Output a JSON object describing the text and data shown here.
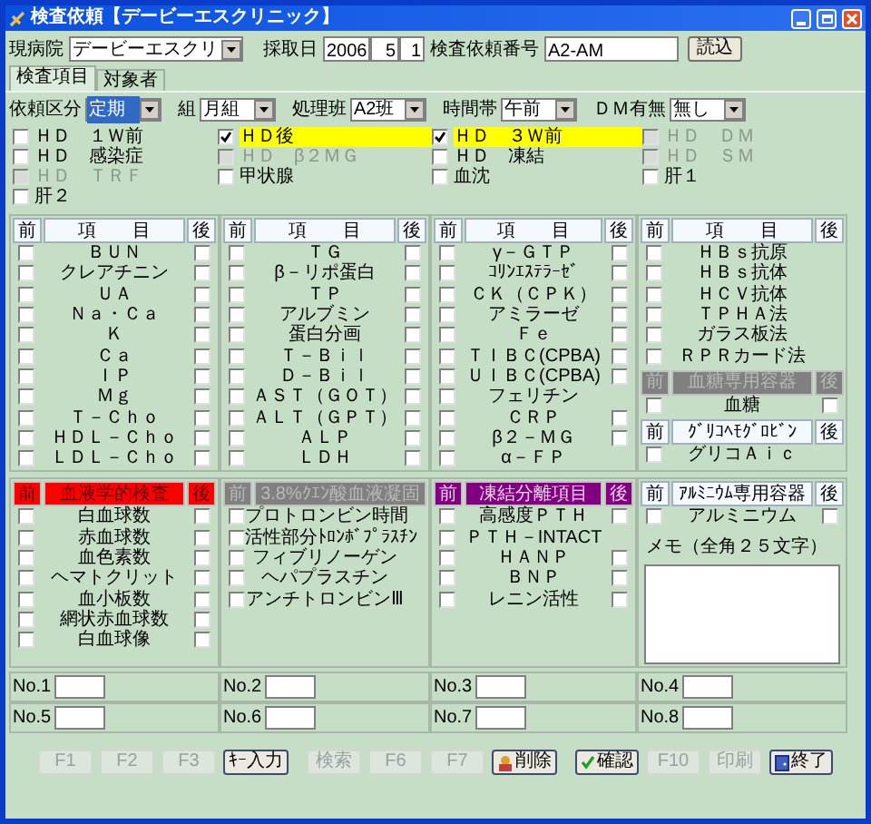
{
  "window": {
    "title": "検査依頼【デービーエスクリニック】"
  },
  "header": {
    "hospital_label": "現病院",
    "hospital": "デービーエスクリ",
    "date_label": "採取日",
    "year": "2006",
    "month": "5",
    "day": "1",
    "request_no_label": "検査依頼番号",
    "request_no": "A2-AM",
    "load_button": "読込"
  },
  "tabs": [
    {
      "label": "検査項目",
      "selected": true
    },
    {
      "label": "対象者",
      "selected": false
    }
  ],
  "filters": [
    {
      "label": "依頼区分",
      "value": "定期",
      "highlighted": true
    },
    {
      "label": "組",
      "value": "月組",
      "highlighted": false
    },
    {
      "label": "処理班",
      "value": "A2班",
      "highlighted": false
    },
    {
      "label": "時間帯",
      "value": "午前",
      "highlighted": false
    },
    {
      "label": "ＤＭ有無",
      "value": "無し",
      "highlighted": false
    }
  ],
  "option_columns": [
    [
      {
        "label": "ＨＤ　１Ｗ前",
        "checked": false,
        "disabled": false
      },
      {
        "label": "ＨＤ　感染症",
        "checked": false,
        "disabled": false
      },
      {
        "label": "ＨＤ　ＴＲＦ",
        "checked": false,
        "disabled": true
      },
      {
        "label": "肝２",
        "checked": false,
        "disabled": false
      }
    ],
    [
      {
        "label": "ＨＤ後",
        "checked": true,
        "disabled": false
      },
      {
        "label": "ＨＤ　β２ＭＧ",
        "checked": false,
        "disabled": true
      },
      {
        "label": "甲状腺",
        "checked": false,
        "disabled": false
      }
    ],
    [
      {
        "label": "ＨＤ　３Ｗ前",
        "checked": true,
        "disabled": false
      },
      {
        "label": "ＨＤ　凍結",
        "checked": false,
        "disabled": false
      },
      {
        "label": "血沈",
        "checked": false,
        "disabled": false
      }
    ],
    [
      {
        "label": "ＨＤ　ＤＭ",
        "checked": false,
        "disabled": true
      },
      {
        "label": "ＨＤ　ＳＭ",
        "checked": false,
        "disabled": true
      },
      {
        "label": "肝１",
        "checked": false,
        "disabled": false
      }
    ]
  ],
  "panels_top": [
    {
      "sections": [
        {
          "header": {
            "kind": "plain",
            "before": "前",
            "title": "項　　目",
            "after": "後"
          },
          "items": [
            {
              "name": "ＢＵＮ",
              "before": false,
              "after": false
            },
            {
              "name": "クレアチニン",
              "before": false,
              "after": false
            },
            {
              "name": "ＵＡ",
              "before": false,
              "after": false
            },
            {
              "name": "Ｎａ・Ｃａ",
              "before": false,
              "after": false
            },
            {
              "name": "Ｋ",
              "before": false,
              "after": false
            },
            {
              "name": "Ｃａ",
              "before": false,
              "after": false
            },
            {
              "name": "ＩＰ",
              "before": false,
              "after": false
            },
            {
              "name": "Ｍｇ",
              "before": false,
              "after": false
            },
            {
              "name": "Ｔ－Ｃｈｏ",
              "before": false,
              "after": false
            },
            {
              "name": "ＨＤＬ－Ｃｈｏ",
              "before": false,
              "after": false
            },
            {
              "name": "ＬＤＬ－Ｃｈｏ",
              "before": false,
              "after": false
            }
          ]
        }
      ]
    },
    {
      "sections": [
        {
          "header": {
            "kind": "plain",
            "before": "前",
            "title": "項　　目",
            "after": "後"
          },
          "items": [
            {
              "name": "ＴＧ",
              "before": false,
              "after": false
            },
            {
              "name": "β－リポ蛋白",
              "before": false,
              "after": false
            },
            {
              "name": "ＴＰ",
              "before": false,
              "after": false
            },
            {
              "name": "アルブミン",
              "before": false,
              "after": false
            },
            {
              "name": "蛋白分画",
              "before": false,
              "after": false
            },
            {
              "name": "Ｔ－Ｂｉｌ",
              "before": false,
              "after": false
            },
            {
              "name": "Ｄ－Ｂｉｌ",
              "before": false,
              "after": false
            },
            {
              "name": "ＡＳＴ（ＧＯＴ）",
              "before": false,
              "after": false
            },
            {
              "name": "ＡＬＴ（ＧＰＴ）",
              "before": false,
              "after": false
            },
            {
              "name": "ＡＬＰ",
              "before": false,
              "after": false
            },
            {
              "name": "ＬＤＨ",
              "before": false,
              "after": false
            }
          ]
        }
      ]
    },
    {
      "sections": [
        {
          "header": {
            "kind": "plain",
            "before": "前",
            "title": "項　　目",
            "after": "後"
          },
          "items": [
            {
              "name": "γ－ＧＴＰ",
              "before": false,
              "after": false
            },
            {
              "name": "ｺﾘﾝｴｽﾃﾗｰｾﾞ",
              "before": false,
              "after": false
            },
            {
              "name": "ＣＫ（ＣＰＫ）",
              "before": false,
              "after": false
            },
            {
              "name": "アミラーゼ",
              "before": false,
              "after": false
            },
            {
              "name": "Ｆｅ",
              "before": false,
              "after": false
            },
            {
              "name": "ＴＩＢＣ(CPBA)",
              "before": false,
              "after": false
            },
            {
              "name": "ＵＩＢＣ(CPBA)",
              "before": false,
              "after": false
            },
            {
              "name": "フェリチン",
              "before": false
            },
            {
              "name": "ＣＲＰ",
              "before": false,
              "after": false
            },
            {
              "name": "β２－ＭＧ",
              "before": false,
              "after": false
            },
            {
              "name": "α－ＦＰ",
              "before": false
            }
          ]
        }
      ]
    },
    {
      "sections": [
        {
          "header": {
            "kind": "plain",
            "before": "前",
            "title": "項　　目",
            "after": "後"
          },
          "items": [
            {
              "name": "ＨＢｓ抗原",
              "before": false
            },
            {
              "name": "ＨＢｓ抗体",
              "before": false
            },
            {
              "name": "ＨＣＶ抗体",
              "before": false
            },
            {
              "name": "ＴＰＨＡ法",
              "before": false
            },
            {
              "name": "ガラス板法",
              "before": false
            },
            {
              "name": "ＲＰＲカード法",
              "before": false
            }
          ]
        },
        {
          "header": {
            "kind": "gray",
            "before": "前",
            "title": "血糖専用容器",
            "after": "後"
          },
          "items": [
            {
              "name": "血糖",
              "before": false,
              "after": false
            }
          ]
        },
        {
          "header": {
            "kind": "plain",
            "before": "前",
            "title": "ｸﾞﾘｺﾍﾓｸﾞﾛﾋﾞﾝ",
            "after": "後"
          },
          "items": [
            {
              "name": "グリコＡｉｃ",
              "before": false
            }
          ]
        }
      ]
    }
  ],
  "panels_bottom": [
    {
      "sections": [
        {
          "header": {
            "kind": "red",
            "before": "前",
            "title": "血液学的検査",
            "after": "後"
          },
          "items": [
            {
              "name": "白血球数",
              "before": false,
              "after": false
            },
            {
              "name": "赤血球数",
              "before": false,
              "after": false
            },
            {
              "name": "血色素数",
              "before": false,
              "after": false
            },
            {
              "name": "ヘマトクリット",
              "before": false,
              "after": false
            },
            {
              "name": "血小板数",
              "before": false,
              "after": false
            },
            {
              "name": "網状赤血球数",
              "before": false,
              "after": false
            },
            {
              "name": "白血球像",
              "before": false,
              "after": false
            }
          ]
        }
      ]
    },
    {
      "sections": [
        {
          "header": {
            "kind": "gray",
            "before": "前",
            "title": "3.8%ｸｴﾝ酸血液凝固"
          },
          "items": [
            {
              "name": "プロトロンビン時間",
              "before": false
            },
            {
              "name": "活性部分ﾄﾛﾝﾎﾞﾌﾟﾗｽﾁﾝ",
              "before": false
            },
            {
              "name": "フィブリノーゲン",
              "before": false
            },
            {
              "name": "ヘパプラスチン",
              "before": false
            },
            {
              "name": "アンチトロンビンⅢ",
              "before": false
            }
          ]
        }
      ]
    },
    {
      "sections": [
        {
          "header": {
            "kind": "purple",
            "before": "前",
            "title": "凍結分離項目",
            "after": "後"
          },
          "items": [
            {
              "name": "高感度ＰＴＨ",
              "before": false,
              "after": false
            },
            {
              "name": "ＰＴＨ－INTACT",
              "before": false
            },
            {
              "name": "ＨＡＮＰ",
              "before": false,
              "after": false
            },
            {
              "name": "ＢＮＰ",
              "before": false,
              "after": false
            },
            {
              "name": "レニン活性",
              "before": false,
              "after": false
            }
          ]
        }
      ]
    },
    {
      "sections": [
        {
          "header": {
            "kind": "plain",
            "before": "前",
            "title": "ｱﾙﾐﾆｳﾑ専用容器",
            "after": "後"
          },
          "items": [
            {
              "name": "アルミニウム",
              "before": false,
              "after": false
            }
          ]
        }
      ],
      "memo_label": "メモ（全角２５文字）"
    }
  ],
  "numbers": [
    {
      "label": "No.1"
    },
    {
      "label": "No.2"
    },
    {
      "label": "No.3"
    },
    {
      "label": "No.4"
    },
    {
      "label": "No.5"
    },
    {
      "label": "No.6"
    },
    {
      "label": "No.7"
    },
    {
      "label": "No.8"
    }
  ],
  "button_groups": [
    [
      {
        "label": "F1",
        "disabled": true,
        "kind": "plain"
      },
      {
        "label": "F2",
        "disabled": true,
        "kind": "plain"
      },
      {
        "label": "F3",
        "disabled": true,
        "kind": "plain"
      },
      {
        "label": "ｷｰ入力",
        "disabled": false,
        "kind": "plain"
      }
    ],
    [
      {
        "label": "検索",
        "disabled": true,
        "kind": "plain"
      },
      {
        "label": "F6",
        "disabled": true,
        "kind": "plain"
      },
      {
        "label": "F7",
        "disabled": true,
        "kind": "plain"
      },
      {
        "label": "削除",
        "disabled": false,
        "kind": "delete"
      }
    ],
    [
      {
        "label": "確認",
        "disabled": false,
        "kind": "check"
      },
      {
        "label": "F10",
        "disabled": true,
        "kind": "plain"
      },
      {
        "label": "印刷",
        "disabled": true,
        "kind": "plain"
      },
      {
        "label": "終了",
        "disabled": false,
        "kind": "exit"
      }
    ]
  ]
}
